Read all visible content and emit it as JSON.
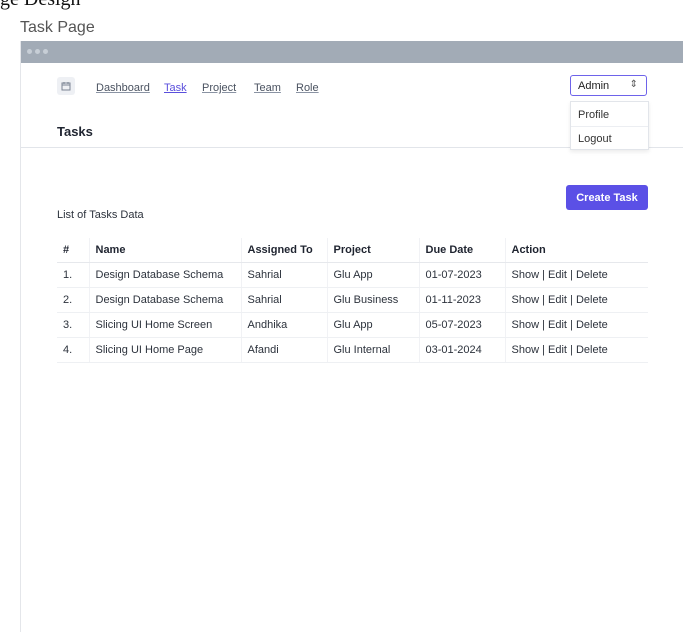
{
  "doc_heading": "ge Design",
  "page_title": "Task Page",
  "nav": {
    "icon": "calendar-icon",
    "links": [
      "Dashboard",
      "Task",
      "Project",
      "Team",
      "Role"
    ],
    "active": "Task"
  },
  "user_menu": {
    "selected": "Admin",
    "options": [
      "Profile",
      "Logout"
    ]
  },
  "section_title": "Tasks",
  "create_button": "Create Task",
  "list_label": "List of Tasks Data",
  "table": {
    "headers": [
      "#",
      "Name",
      "Assigned To",
      "Project",
      "Due Date",
      "Action"
    ],
    "rows": [
      [
        "1.",
        "Design Database Schema",
        "Sahrial",
        "Glu App",
        "01-07-2023"
      ],
      [
        "2.",
        "Design Database Schema",
        "Sahrial",
        "Glu Business",
        "01-11-2023"
      ],
      [
        "3.",
        "Slicing UI Home Screen",
        "Andhika",
        "Glu App",
        "05-07-2023"
      ],
      [
        "4.",
        "Slicing UI Home Page",
        "Afandi",
        "Glu Internal",
        "03-01-2024"
      ]
    ],
    "actions": [
      "Show",
      "Edit",
      "Delete"
    ],
    "action_separator": " | "
  },
  "colors": {
    "accent": "#5b50e6",
    "window_bar": "#a2abb6"
  }
}
